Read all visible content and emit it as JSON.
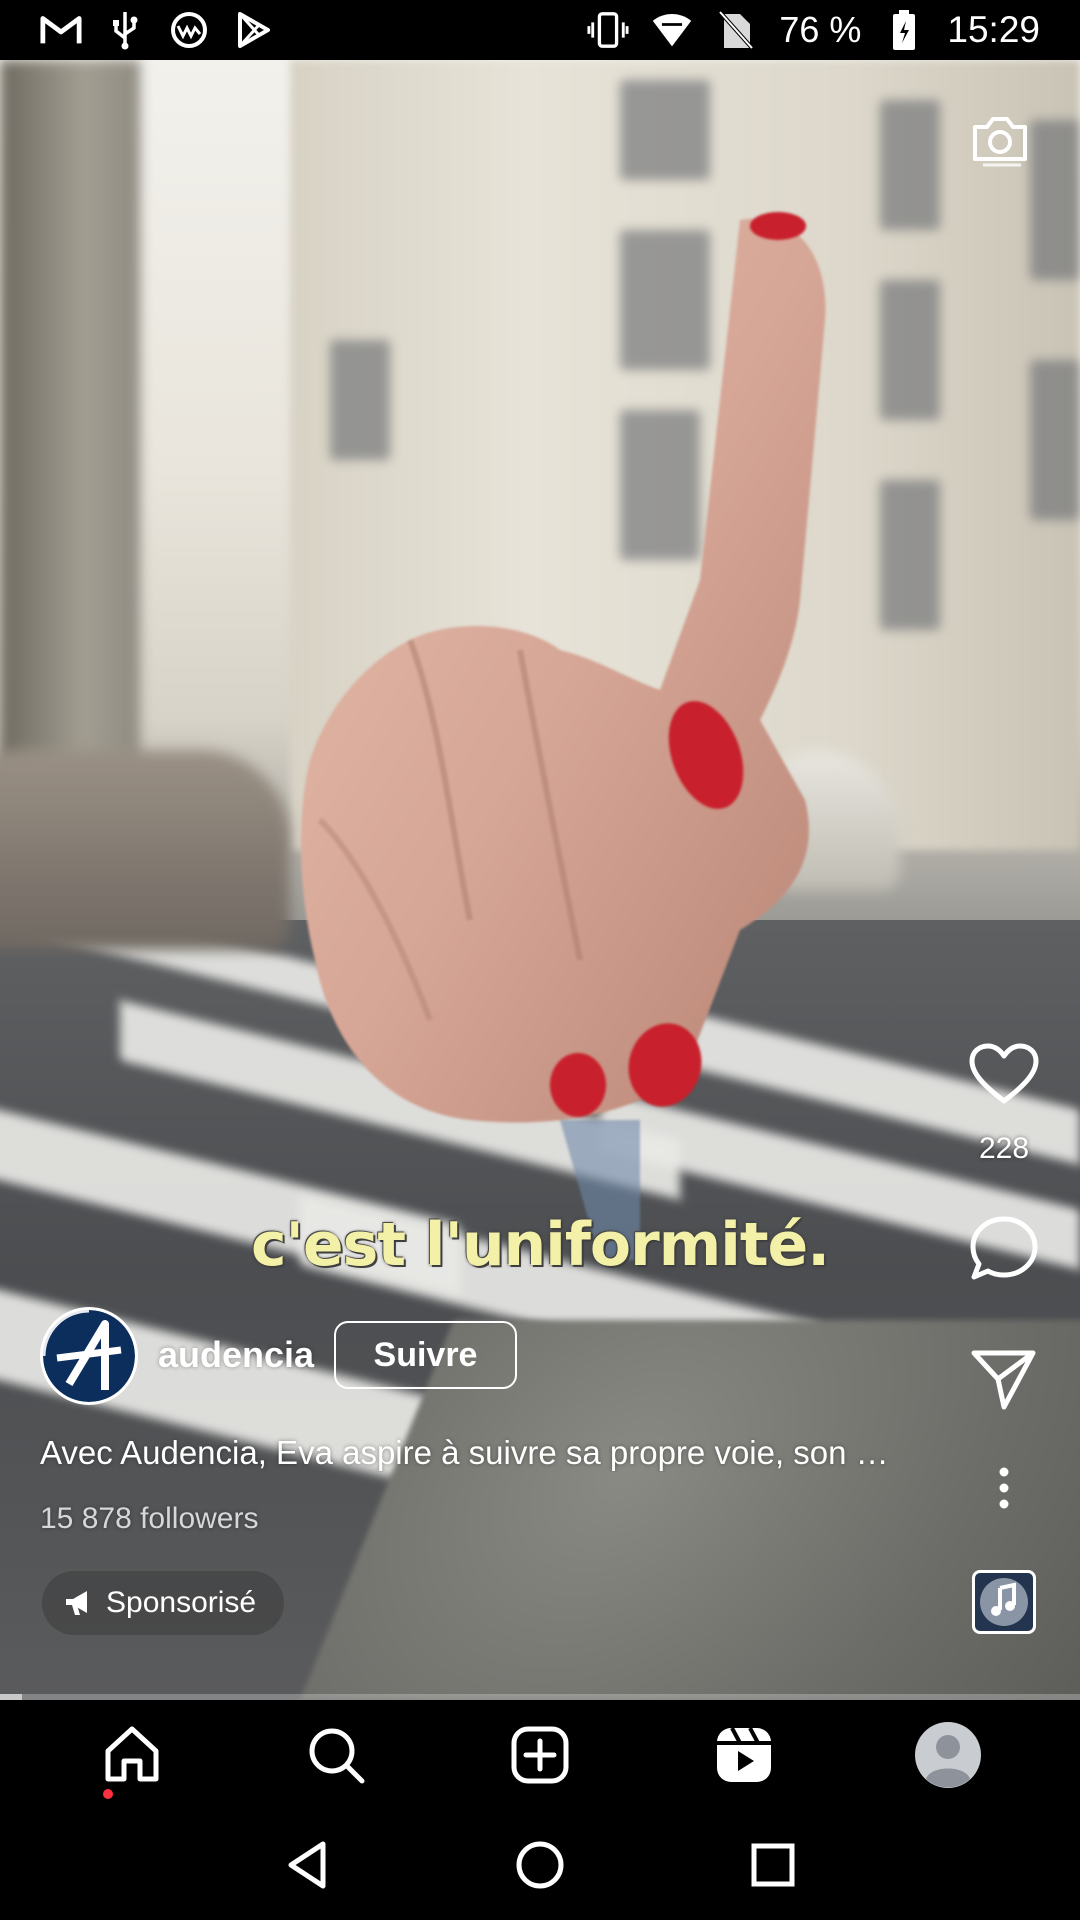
{
  "status_bar": {
    "left_icons": [
      "gmail-icon",
      "usb-icon",
      "web-app-icon",
      "play-store-icon"
    ],
    "battery_percent": "76 %",
    "time": "15:29"
  },
  "video": {
    "subtitle": "c'est l'uniformité.",
    "progress": 0.02
  },
  "actions": {
    "like_count": "228",
    "icons": [
      "camera-icon",
      "heart-icon",
      "comment-icon",
      "share-icon",
      "more-icon",
      "audio-icon"
    ]
  },
  "post": {
    "username": "audencia",
    "follow_label": "Suivre",
    "caption": "Avec Audencia, Eva aspire à suivre sa propre voie, son …",
    "followers": "15 878 followers",
    "sponsored_label": "Sponsorisé"
  },
  "bottom_nav": {
    "items": [
      "home-icon",
      "search-icon",
      "create-icon",
      "reels-icon",
      "profile-icon"
    ]
  },
  "system_nav": [
    "back-icon",
    "home-circle-icon",
    "recents-icon"
  ],
  "colors": {
    "subtitle": "#f3f0a8",
    "notification_dot": "#ff3040",
    "brand_avatar": "#0c2e5c"
  }
}
